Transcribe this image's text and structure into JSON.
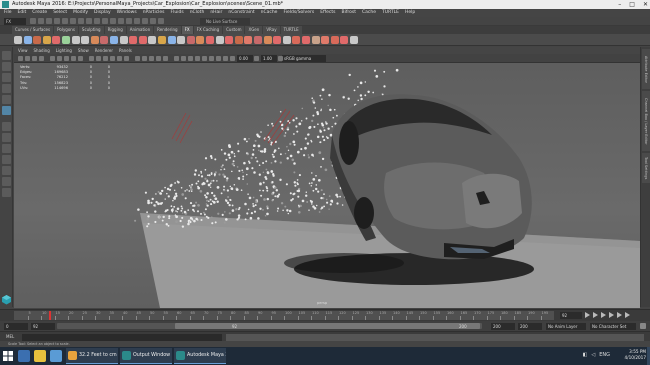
{
  "window": {
    "title": "Autodesk Maya 2016: E:\\Projects\\PersonalMaya_Projects\\Car_Explosion\\Car_Explosion\\scenes\\Scene_01.mb*",
    "min_icon": "minimize-icon",
    "max_icon": "maximize-icon",
    "close_icon": "close-icon"
  },
  "menubar": [
    "File",
    "Edit",
    "Create",
    "Select",
    "Modify",
    "Display",
    "Windows",
    "nParticles",
    "Fluids",
    "nCloth",
    "nHair",
    "nConstraint",
    "nCache",
    "Fields/Solvers",
    "Effects",
    "Bifrost",
    "Cache",
    "TURTLE",
    "Help"
  ],
  "statusline": {
    "mode": "FX",
    "live_surface": "No Live Surface"
  },
  "shelf_tabs": [
    "Curves / Surfaces",
    "Polygons",
    "Sculpting",
    "Rigging",
    "Animation",
    "Rendering",
    "FX",
    "FX Caching",
    "Custom",
    "XGen",
    "VRay",
    "TURTLE"
  ],
  "shelf_active": "FX",
  "panel_menu": [
    "View",
    "Shading",
    "Lighting",
    "Show",
    "Renderer",
    "Panels"
  ],
  "panel_bar": {
    "field_a": "0.00",
    "field_b": "1.00",
    "color_space": "sRGB gamma"
  },
  "hud": {
    "rows": [
      {
        "label": "Verts:",
        "a": "93432",
        "b": "0",
        "c": "0"
      },
      {
        "label": "Edges:",
        "a": "169683",
        "b": "0",
        "c": "0"
      },
      {
        "label": "Faces:",
        "a": "76212",
        "b": "0",
        "c": "0"
      },
      {
        "label": "Tris:",
        "a": "156823",
        "b": "0",
        "c": "0"
      },
      {
        "label": "UVs:",
        "a": "114696",
        "b": "0",
        "c": "0"
      }
    ]
  },
  "viewport": {
    "camera": "persp"
  },
  "right_tabs": [
    "Attribute Editor",
    "Channel Box / Layer Editor",
    "Tool Settings"
  ],
  "timeslider": {
    "ticks": [
      "5",
      "10",
      "15",
      "20",
      "25",
      "30",
      "35",
      "40",
      "45",
      "50",
      "55",
      "60",
      "65",
      "70",
      "75",
      "80",
      "85",
      "90",
      "95",
      "100",
      "105",
      "110",
      "115",
      "120",
      "125",
      "130",
      "135",
      "140",
      "145",
      "150",
      "155",
      "160",
      "165",
      "170",
      "175",
      "180",
      "185",
      "190",
      "195"
    ],
    "current_frame": "92"
  },
  "range": {
    "start": "0",
    "playback_start": "92",
    "playback_end": "200",
    "end": "200",
    "range_end_label": "200",
    "anim_layer": "No Anim Layer",
    "character_set": "No Character Set"
  },
  "cmdline": {
    "label": "MEL"
  },
  "helpline": "Scale Tool: Select an object to scale.",
  "taskbar": {
    "tasks": [
      {
        "label": "32.2 Feet to cm - G...",
        "icon": "chrome-icon",
        "color": "#e8a33d"
      },
      {
        "label": "Output Window",
        "icon": "maya-output-icon",
        "color": "#2b8a8a"
      },
      {
        "label": "Autodesk Maya 201...",
        "icon": "maya-icon",
        "color": "#2b8a8a"
      }
    ],
    "time": "3:55 PM",
    "date": "4/10/2017",
    "lang": "ENG"
  },
  "colors": {
    "accent": "#5285a6",
    "taskbar": "#1e2a38"
  }
}
